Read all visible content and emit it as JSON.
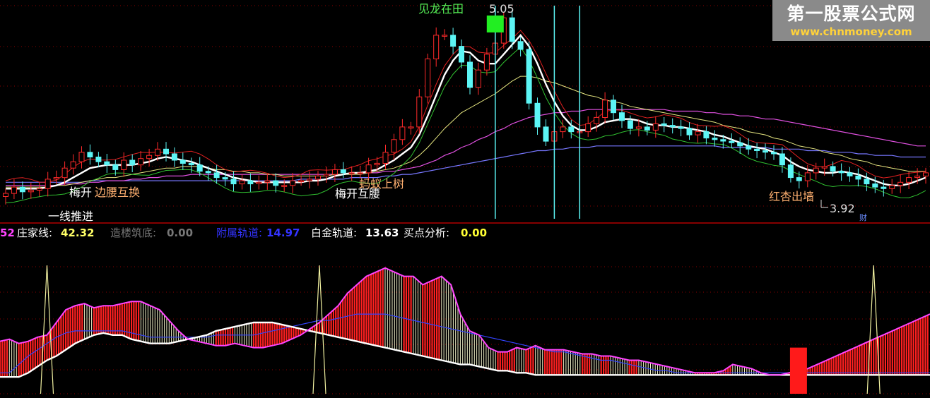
{
  "watermark": {
    "title": "第一股票公式网",
    "url": "www.chnmoney.com"
  },
  "upper_panel": {
    "peak_label": "5.05",
    "low_label": "3.92",
    "corner_label": "财",
    "signals": [
      {
        "text": "梅开",
        "color": "#ffffff"
      },
      {
        "text": "边腰互换",
        "color": "#ffb070"
      },
      {
        "text": "梅开互腰",
        "color": "#ffffff"
      },
      {
        "text": "蚂蚁上树",
        "color": "#ffb070"
      },
      {
        "text": "红杏出墙",
        "color": "#ffb070"
      },
      {
        "text": "一线推进",
        "color": "#ffffff"
      },
      {
        "text": "见龙在田",
        "color": "#55ee55"
      }
    ]
  },
  "lower_panel": {
    "legend": [
      {
        "label": "52",
        "color": "#ff44ff"
      },
      {
        "label": "庄家线:",
        "color": "#ffffff"
      },
      {
        "label": "42.32",
        "color": "#ffff66"
      },
      {
        "label": "造楼筑底:",
        "color": "#777777"
      },
      {
        "label": "0.00",
        "color": "#777777"
      },
      {
        "label": "附属轨道:",
        "color": "#3333ff"
      },
      {
        "label": "14.97",
        "color": "#3333ff"
      },
      {
        "label": "白金轨道:",
        "color": "#ffffff"
      },
      {
        "label": "13.63",
        "color": "#ffffff"
      },
      {
        "label": "买点分析:",
        "color": "#ffffff"
      },
      {
        "label": "0.00",
        "color": "#ffff33"
      }
    ]
  },
  "chart_data": [
    {
      "type": "candlestick",
      "panel": "upper",
      "n": 110,
      "close": [
        3.92,
        3.96,
        3.93,
        3.94,
        3.95,
        4.01,
        4.02,
        4.08,
        4.12,
        4.18,
        4.15,
        4.12,
        4.1,
        4.07,
        4.13,
        4.1,
        4.14,
        4.16,
        4.2,
        4.17,
        4.13,
        4.11,
        4.1,
        4.06,
        4.05,
        4.02,
        4.01,
        3.98,
        4.0,
        3.98,
        3.99,
        4.0,
        3.97,
        3.97,
        4.0,
        4.0,
        4.01,
        4.03,
        4.04,
        4.07,
        4.05,
        4.05,
        4.05,
        4.1,
        4.11,
        4.18,
        4.26,
        4.34,
        4.34,
        4.53,
        4.77,
        4.92,
        4.92,
        4.85,
        4.75,
        4.59,
        4.7,
        4.8,
        4.87,
        5.03,
        4.88,
        4.83,
        4.49,
        4.34,
        4.25,
        4.31,
        4.34,
        4.31,
        4.31,
        4.36,
        4.4,
        4.51,
        4.43,
        4.38,
        4.33,
        4.34,
        4.32,
        4.36,
        4.35,
        4.34,
        4.33,
        4.29,
        4.31,
        4.27,
        4.26,
        4.25,
        4.24,
        4.22,
        4.2,
        4.19,
        4.18,
        4.17,
        4.1,
        4.02,
        4.0,
        4.05,
        4.08,
        4.09,
        4.06,
        4.05,
        4.03,
        4.01,
        3.98,
        3.96,
        3.95,
        3.97,
        3.99,
        4.02,
        4.03,
        4.05
      ],
      "ma_short": [
        3.95,
        3.95,
        3.95,
        3.95,
        3.95,
        3.96,
        3.97,
        3.99,
        4.02,
        4.05,
        4.08,
        4.09,
        4.1,
        4.1,
        4.1,
        4.1,
        4.11,
        4.12,
        4.14,
        4.15,
        4.14,
        4.13,
        4.12,
        4.1,
        4.08,
        4.06,
        4.04,
        4.02,
        4.01,
        4.0,
        3.99,
        3.99,
        3.99,
        3.99,
        3.99,
        3.99,
        4.0,
        4.0,
        4.01,
        4.03,
        4.04,
        4.05,
        4.05,
        4.06,
        4.07,
        4.1,
        4.13,
        4.17,
        4.21,
        4.29,
        4.41,
        4.54,
        4.67,
        4.76,
        4.82,
        4.81,
        4.76,
        4.74,
        4.74,
        4.8,
        4.86,
        4.92,
        4.85,
        4.74,
        4.61,
        4.5,
        4.41,
        4.35,
        4.32,
        4.32,
        4.34,
        4.37,
        4.38,
        4.39,
        4.39,
        4.38,
        4.36,
        4.35,
        4.35,
        4.34,
        4.34,
        4.33,
        4.32,
        4.31,
        4.29,
        4.28,
        4.26,
        4.24,
        4.22,
        4.21,
        4.2,
        4.18,
        4.16,
        4.12,
        4.09,
        4.07,
        4.06,
        4.05,
        4.05,
        4.06,
        4.05,
        4.04,
        4.02,
        4.0,
        3.98,
        3.97,
        3.97,
        3.98,
        4.0,
        4.02
      ],
      "ma_mid": [
        3.96,
        3.96,
        3.96,
        3.96,
        3.96,
        3.96,
        3.97,
        3.97,
        3.98,
        3.99,
        4.0,
        4.01,
        4.02,
        4.02,
        4.03,
        4.04,
        4.05,
        4.06,
        4.07,
        4.08,
        4.08,
        4.09,
        4.09,
        4.09,
        4.08,
        4.07,
        4.07,
        4.06,
        4.06,
        4.05,
        4.05,
        4.04,
        4.04,
        4.03,
        4.03,
        4.03,
        4.03,
        4.03,
        4.03,
        4.04,
        4.04,
        4.04,
        4.04,
        4.05,
        4.06,
        4.07,
        4.08,
        4.1,
        4.12,
        4.16,
        4.21,
        4.27,
        4.33,
        4.38,
        4.43,
        4.46,
        4.49,
        4.52,
        4.55,
        4.59,
        4.63,
        4.66,
        4.66,
        4.65,
        4.63,
        4.62,
        4.6,
        4.58,
        4.56,
        4.54,
        4.53,
        4.51,
        4.5,
        4.49,
        4.47,
        4.46,
        4.45,
        4.44,
        4.43,
        4.42,
        4.41,
        4.4,
        4.39,
        4.38,
        4.37,
        4.35,
        4.34,
        4.33,
        4.31,
        4.3,
        4.29,
        4.27,
        4.26,
        4.24,
        4.22,
        4.21,
        4.2,
        4.18,
        4.17,
        4.16,
        4.14,
        4.13,
        4.12,
        4.1,
        4.09,
        4.08,
        4.07,
        4.06,
        4.06,
        4.06
      ],
      "ma_long": [
        3.97,
        3.97,
        3.97,
        3.97,
        3.97,
        3.97,
        3.97,
        3.98,
        3.98,
        3.98,
        3.99,
        3.99,
        4.0,
        4.0,
        4.0,
        4.01,
        4.01,
        4.02,
        4.02,
        4.03,
        4.03,
        4.03,
        4.04,
        4.04,
        4.04,
        4.04,
        4.04,
        4.04,
        4.04,
        4.04,
        4.04,
        4.04,
        4.04,
        4.04,
        4.04,
        4.04,
        4.04,
        4.04,
        4.04,
        4.04,
        4.04,
        4.05,
        4.05,
        4.05,
        4.05,
        4.06,
        4.06,
        4.07,
        4.08,
        4.09,
        4.11,
        4.13,
        4.16,
        4.18,
        4.21,
        4.23,
        4.26,
        4.28,
        4.31,
        4.33,
        4.36,
        4.38,
        4.4,
        4.41,
        4.42,
        4.43,
        4.43,
        4.44,
        4.44,
        4.45,
        4.45,
        4.45,
        4.45,
        4.45,
        4.45,
        4.45,
        4.45,
        4.45,
        4.45,
        4.44,
        4.44,
        4.44,
        4.44,
        4.43,
        4.43,
        4.42,
        4.42,
        4.41,
        4.41,
        4.4,
        4.39,
        4.39,
        4.38,
        4.37,
        4.36,
        4.35,
        4.34,
        4.33,
        4.32,
        4.31,
        4.3,
        4.29,
        4.28,
        4.27,
        4.26,
        4.25,
        4.24,
        4.23,
        4.22,
        4.22
      ],
      "ma_flat": [
        3.99,
        3.99,
        3.99,
        3.99,
        3.99,
        3.99,
        3.99,
        3.99,
        3.99,
        3.99,
        4.0,
        4.0,
        4.0,
        4.0,
        4.0,
        4.0,
        4.0,
        4.0,
        4.0,
        4.0,
        4.0,
        4.0,
        4.0,
        4.0,
        4.0,
        4.0,
        4.0,
        4.0,
        4.0,
        4.0,
        4.0,
        4.0,
        4.0,
        4.0,
        4.0,
        4.01,
        4.01,
        4.01,
        4.01,
        4.01,
        4.01,
        4.02,
        4.02,
        4.02,
        4.02,
        4.03,
        4.03,
        4.04,
        4.04,
        4.05,
        4.06,
        4.07,
        4.08,
        4.09,
        4.1,
        4.11,
        4.12,
        4.13,
        4.14,
        4.15,
        4.16,
        4.17,
        4.18,
        4.19,
        4.19,
        4.2,
        4.2,
        4.21,
        4.21,
        4.21,
        4.22,
        4.22,
        4.22,
        4.22,
        4.22,
        4.22,
        4.22,
        4.22,
        4.22,
        4.22,
        4.22,
        4.22,
        4.22,
        4.22,
        4.22,
        4.21,
        4.21,
        4.21,
        4.21,
        4.21,
        4.21,
        4.2,
        4.2,
        4.2,
        4.2,
        4.19,
        4.19,
        4.19,
        4.18,
        4.18,
        4.18,
        4.17,
        4.17,
        4.16,
        4.16,
        4.16,
        4.15,
        4.15,
        4.15,
        4.15
      ],
      "signal_days": [
        58,
        65,
        68
      ],
      "markers": [
        {
          "day": 58,
          "label": "5.05"
        },
        {
          "day": 104,
          "label": "3.92"
        }
      ]
    },
    {
      "type": "area",
      "panel": "lower",
      "series": [
        {
          "name": "庄家线",
          "values": [
            35,
            36,
            34,
            35,
            37,
            38,
            44,
            50,
            52,
            53,
            51,
            52,
            52,
            53,
            54,
            54,
            52,
            50,
            45,
            40,
            36,
            35,
            34,
            33,
            33,
            34,
            33,
            32,
            32,
            33,
            34,
            36,
            38,
            41,
            44,
            48,
            52,
            58,
            62,
            66,
            68,
            70,
            68,
            66,
            66,
            62,
            64,
            66,
            62,
            48,
            40,
            38,
            32,
            30,
            30,
            32,
            31,
            33,
            31,
            31,
            31,
            30,
            29,
            29,
            28,
            28,
            27,
            26,
            26,
            25,
            24,
            23,
            22,
            21,
            20,
            20,
            20,
            21,
            24,
            23,
            22,
            20,
            19,
            19,
            20,
            21,
            22,
            24,
            26,
            28,
            30,
            32,
            34,
            36,
            38,
            40,
            42,
            44,
            46,
            48
          ]
        },
        {
          "name": "附属轨道",
          "values": [
            20,
            20,
            24,
            28,
            31,
            34,
            37,
            39,
            40,
            40,
            40,
            40,
            40,
            40,
            39,
            38,
            37,
            37,
            37,
            37,
            37,
            37,
            37,
            38,
            38,
            38,
            38,
            38,
            39,
            40,
            41,
            42,
            43,
            44,
            45,
            45,
            46,
            47,
            48,
            48,
            48,
            48,
            47,
            46,
            45,
            44,
            43,
            42,
            41,
            40,
            39,
            38,
            37,
            36,
            35,
            34,
            33,
            32,
            31,
            30,
            30,
            29,
            28,
            27,
            26,
            26,
            25,
            24,
            23,
            22,
            21,
            21,
            20,
            20,
            20,
            20,
            20,
            20,
            20,
            20,
            20,
            20,
            20,
            20,
            20,
            20,
            20,
            20,
            20,
            20,
            20,
            20,
            20,
            20,
            20,
            20,
            20,
            20,
            20,
            20
          ]
        },
        {
          "name": "白金轨道",
          "values": [
            18,
            18,
            18,
            20,
            23,
            26,
            28,
            31,
            34,
            36,
            38,
            39,
            38,
            38,
            36,
            35,
            34,
            34,
            34,
            35,
            36,
            37,
            38,
            40,
            41,
            42,
            43,
            44,
            44,
            44,
            43,
            42,
            41,
            40,
            39,
            38,
            37,
            36,
            35,
            34,
            33,
            32,
            31,
            30,
            29,
            28,
            27,
            26,
            25,
            24,
            24,
            23,
            22,
            21,
            21,
            20,
            20,
            19,
            19,
            19,
            19,
            19,
            19,
            19,
            19,
            19,
            19,
            19,
            19,
            19,
            19,
            19,
            19,
            19,
            19,
            19,
            19,
            19,
            19,
            19,
            19,
            19,
            19,
            19,
            19,
            19,
            19,
            19,
            19,
            19,
            19,
            19,
            19,
            19,
            19,
            19,
            19,
            19,
            19,
            19
          ]
        }
      ],
      "spikes": [
        {
          "x": 5
        },
        {
          "x": 34
        },
        {
          "x": 93
        }
      ],
      "red_bar": {
        "x": 85,
        "value": 32
      }
    }
  ]
}
